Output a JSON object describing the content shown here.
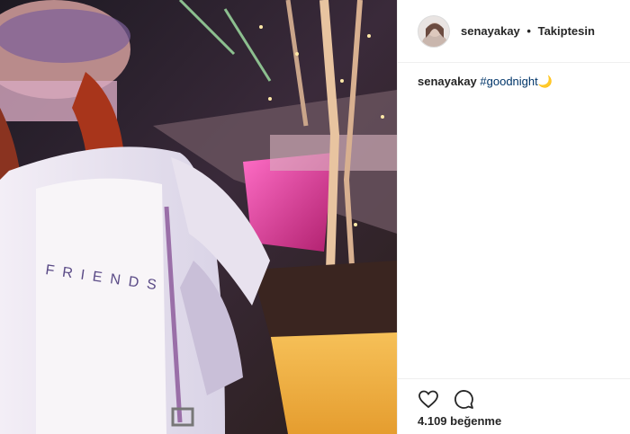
{
  "post": {
    "username": "senayakay",
    "separator": "•",
    "follow_status": "Takiptesin",
    "caption_user": "senayakay",
    "caption_tag": "#goodnight",
    "caption_emoji": "🌙",
    "likes_text": "4.109 beğenme",
    "shirt_text": "FRIENDS"
  },
  "icons": {
    "like": "heart-icon",
    "comment": "comment-icon"
  }
}
